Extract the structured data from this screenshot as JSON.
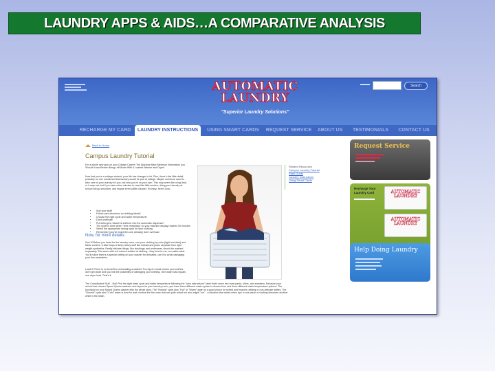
{
  "slide": {
    "title": "LAUNDRY APPS & AIDS…A COMPARATIVE ANALYSIS"
  },
  "site": {
    "logo_line1": "AUTOMATIC",
    "logo_line2": "LAUNDRY",
    "tagline": "\"Superior Laundry Solutions\"",
    "search_button": "Search",
    "nav": [
      "RECHARGE MY CARD",
      "LAUNDRY INSTRUCTIONS",
      "USING SMART CARDS",
      "REQUEST SERVICE",
      "ABOUT US",
      "TESTIMONIALS",
      "CONTACT US"
    ],
    "active_tab": "LAUNDRY INSTRUCTIONS"
  },
  "content": {
    "breadcrumb": "Back to Home",
    "title": "Campus Laundry Tutorial",
    "intro": "For a whole new spin on your College Career! The Absolute Bare Minimum Information you Should Know Before Being Left Alone With A Loaded Washer and Dryer!",
    "para2": "Now that you're a college student, your life has changed a lot. Plus, there's this little detail, probably no one mentioned that laundry would be part of college. Maybe someone used to take care of your laundry for you, but now you're on your own. This may seem like a big deal, or it may not, but if you take a few minutes to read this little section, doing your laundry at school will go smoother, and maybe even a little cleaner. It's easy; here's how:",
    "bullets": [
      "Sort your stuff!",
      "Follow care directions on clothing labels!",
      "Choose the right cycle and water temperature!",
      "Don't overload!",
      "Put detergent, bleach & softener into the automatic dispenser!",
      "The cycle is done when \"time remaining\" on your machine display reaches 00 minutes",
      "Select the appropriate drying cycle for your clothing",
      "Remember (you've heard this one already) don't overload"
    ],
    "subhead": "Now, for more details:",
    "para3": "Sort It! Before you head for the laundry room, sort your clothing by color (light and dark) and fabric content. It also helps to keep heavy stuff like sweats and jeans separate from light weight synthetics. Really delicate things, like stockings and underwear, should be washed separately. The same with red colored articles of clothing - they tend to run, no matter what. You'll notice there's a special setting on your washer for delicates, use it to avoid damaging your fine washables.",
    "para4": "Load It! There is no benefit to overloading a washer! Too big of a load means your clothes don't get clean and you risk the possibility of damaging your clothing. One wash load equals one dryer load. That's it.",
    "para5": "The Complicated Stuff... Not! Pick the right wash cycle and water temperature following the \"care instructions\" label that's sewn into most pants, shirts, and sweaters. Because your school has chosen Speed Queen washers and dryers for your laundry room, you have three different wash cycles to choose from and three different water temperature options. The touchpad on your Speed Queen washer tells the whole story. The \"Normal\" cycle plus \"Hot\" or \"Warm\" water is a good choice for sorted and heavier clothing or non-delicate whites. The \"Normal\" cycle plus \"Cold\" water is best for dark clothes like the ones that are quite soiled but also might \"run\" - a situation that arises when dye in one piece of clothing dissolves another while in the wash."
  },
  "related": {
    "title": "Related Resources",
    "links": [
      "Campus Laundry Tutorial",
      "Stain Guide",
      "Laundry Instructions",
      "Using Smart Cards"
    ]
  },
  "widgets": {
    "request_title": "Request Service",
    "recharge_title": "Recharge Your Laundry Card",
    "help_title": "Help Doing Laundry"
  },
  "colors": {
    "slide_title_bg": "#14792e",
    "site_header": "#3d67c6",
    "logo_red": "#c8203c",
    "widget_green": "#8fb43c",
    "widget_blue": "#4d9be3"
  }
}
